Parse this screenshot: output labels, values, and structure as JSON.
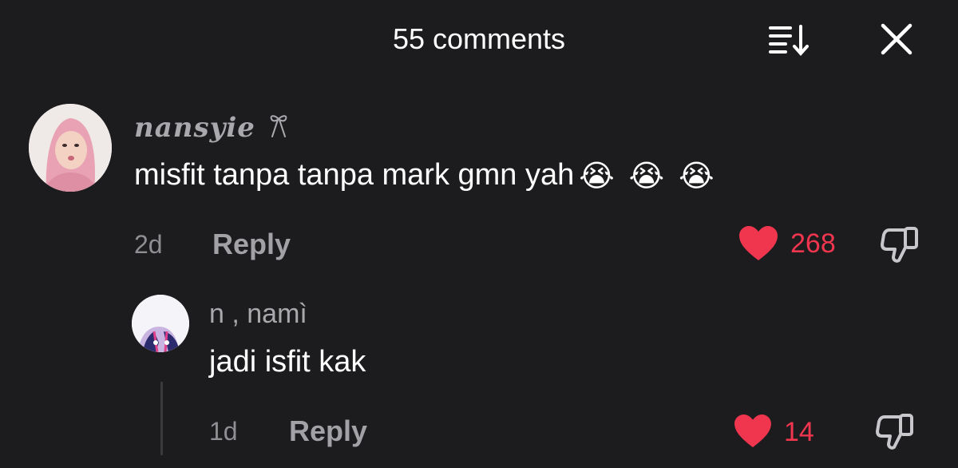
{
  "header": {
    "title": "55 comments"
  },
  "icons": {
    "sort": "sort-icon",
    "close": "close-icon",
    "heart": "heart-icon",
    "dislike": "thumbs-down-icon",
    "badge": "bow-icon"
  },
  "colors": {
    "background": "#1c1c1e",
    "like": "#f0354f",
    "muted": "#8e8e93"
  },
  "comment": {
    "username": "nansyie",
    "text": "misfit tanpa tanpa mark gmn yah",
    "emojis": [
      "😭",
      "😭",
      "😭"
    ],
    "age": "2d",
    "reply_label": "Reply",
    "likes": "268"
  },
  "reply": {
    "username": "n , namì",
    "text": "jadi isfit kak",
    "age": "1d",
    "reply_label": "Reply",
    "likes": "14"
  }
}
